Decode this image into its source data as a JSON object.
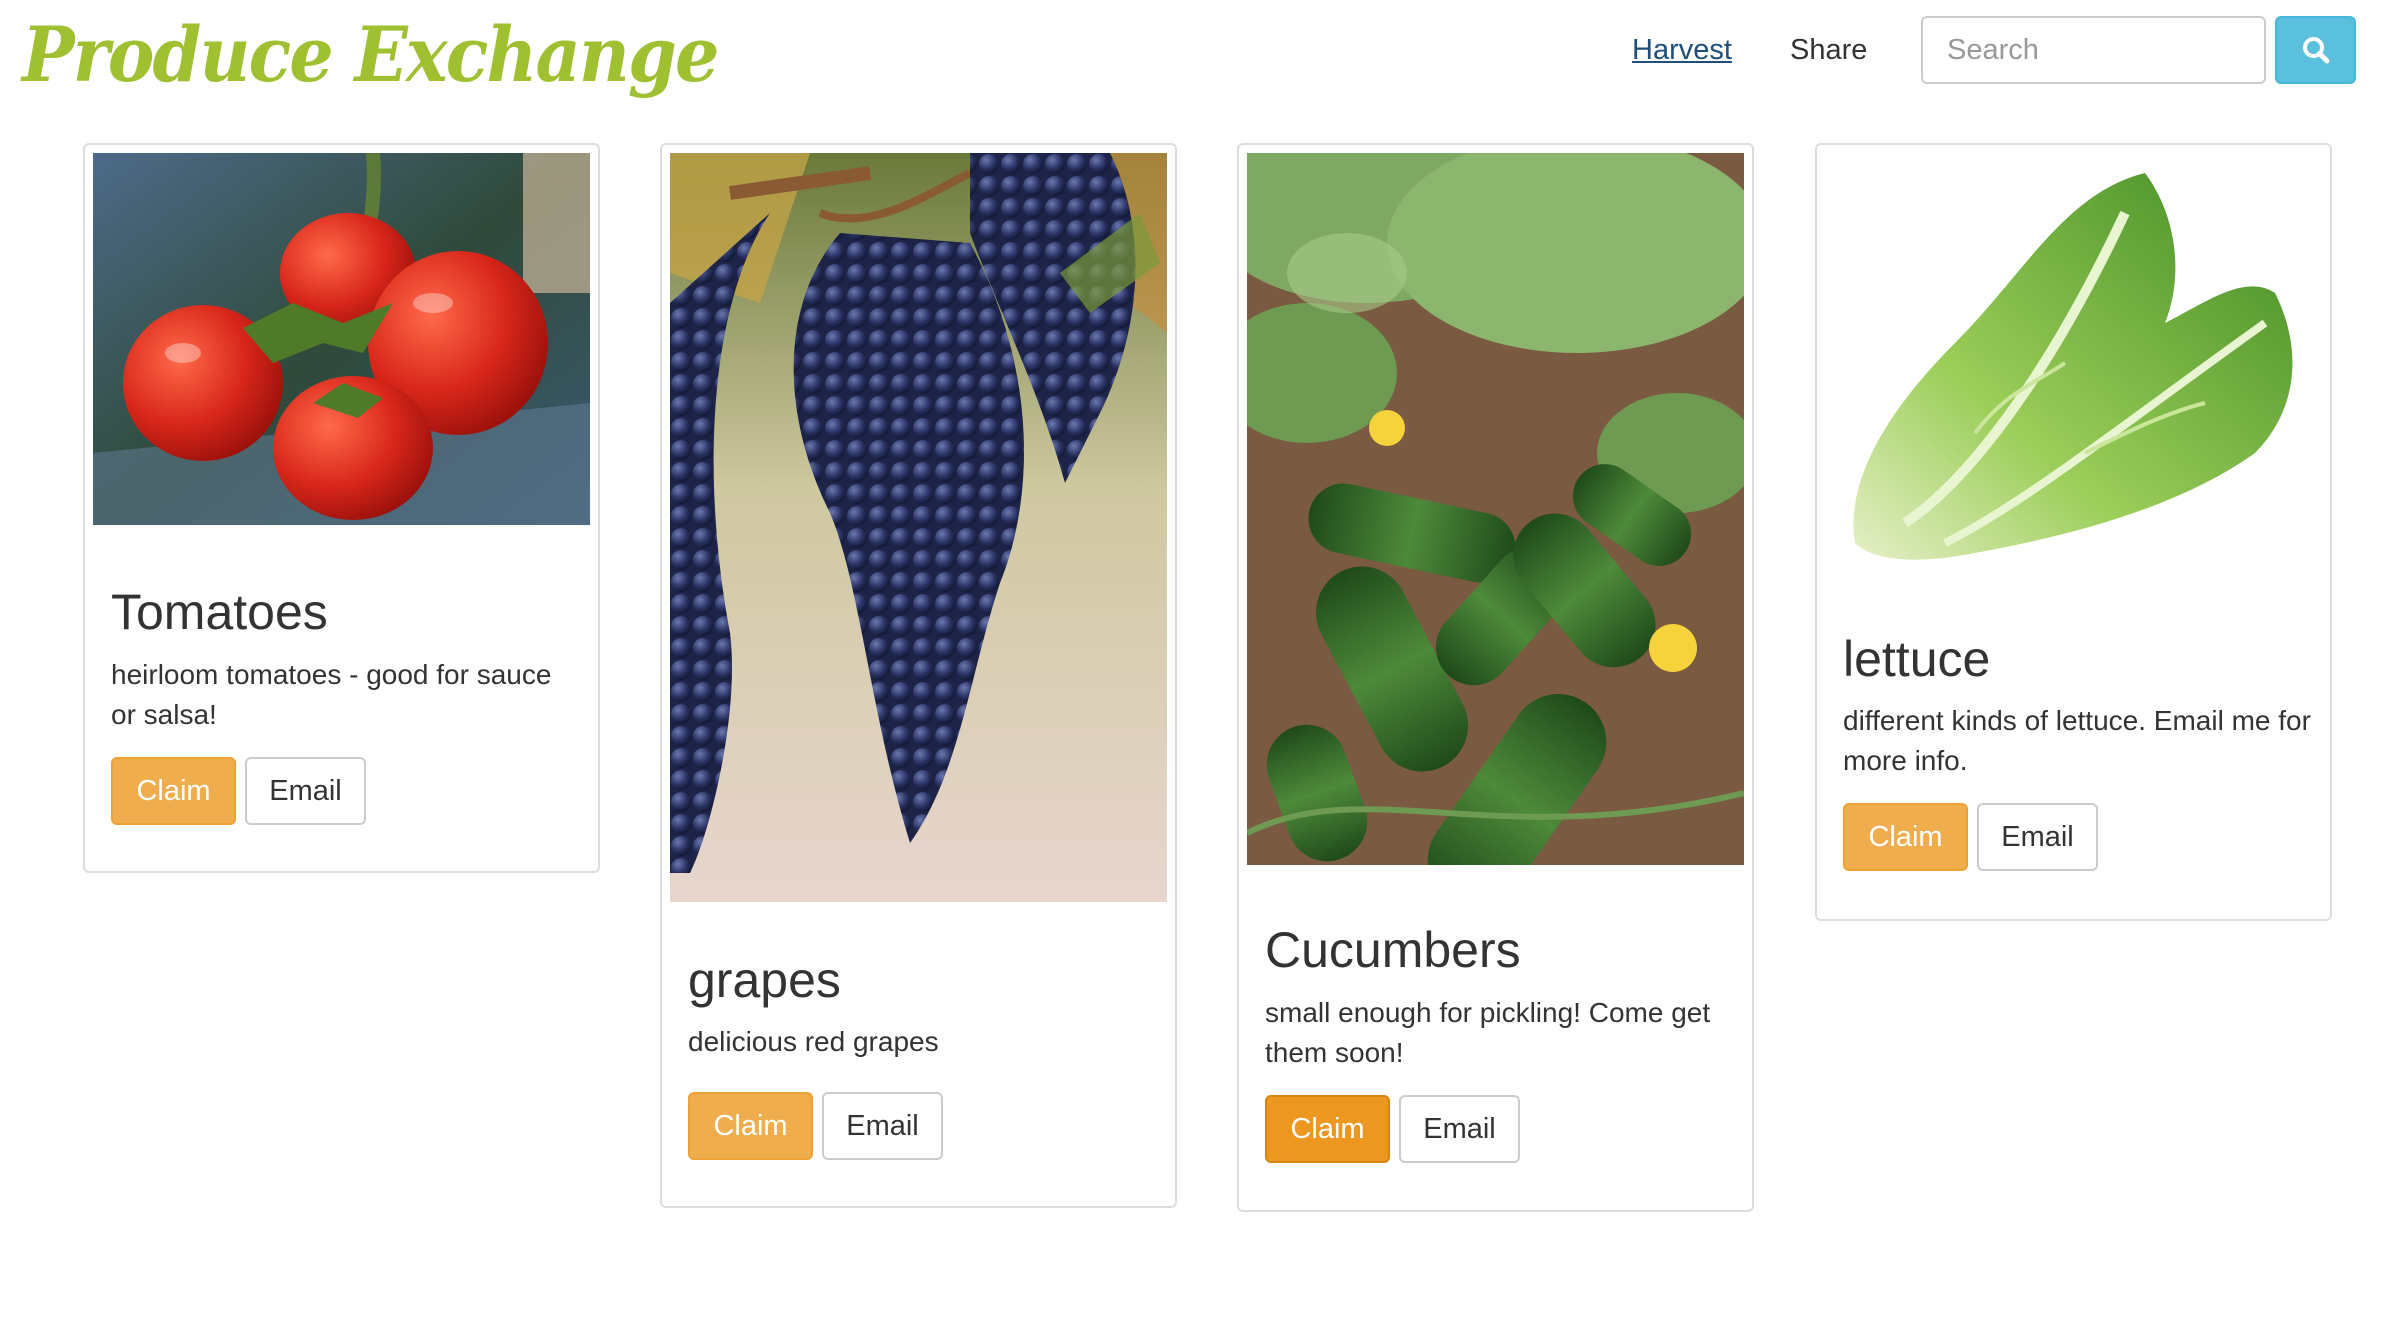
{
  "brand": {
    "name": "Produce Exchange",
    "color": "#9fc131"
  },
  "nav": {
    "links": [
      {
        "label": "Harvest",
        "active": true
      },
      {
        "label": "Share",
        "active": false
      }
    ],
    "search": {
      "placeholder": "Search",
      "value": "",
      "button_icon": "search-icon"
    }
  },
  "colors": {
    "claim": "#f0ad4e",
    "search_button": "#5bc0de",
    "link_active": "#1f4e7a"
  },
  "cards": [
    {
      "title": "Tomatoes",
      "description": "heirloom tomatoes - good for sauce or salsa!",
      "image": "tomatoes-photo",
      "claim_label": "Claim",
      "email_label": "Email"
    },
    {
      "title": "grapes",
      "description": "delicious red grapes",
      "image": "grapes-photo",
      "claim_label": "Claim",
      "email_label": "Email"
    },
    {
      "title": "Cucumbers",
      "description": "small enough for pickling! Come get them soon!",
      "image": "cucumbers-photo",
      "claim_label": "Claim",
      "email_label": "Email"
    },
    {
      "title": "lettuce",
      "description": "different kinds of lettuce. Email me for more info.",
      "image": "lettuce-photo",
      "claim_label": "Claim",
      "email_label": "Email"
    }
  ]
}
